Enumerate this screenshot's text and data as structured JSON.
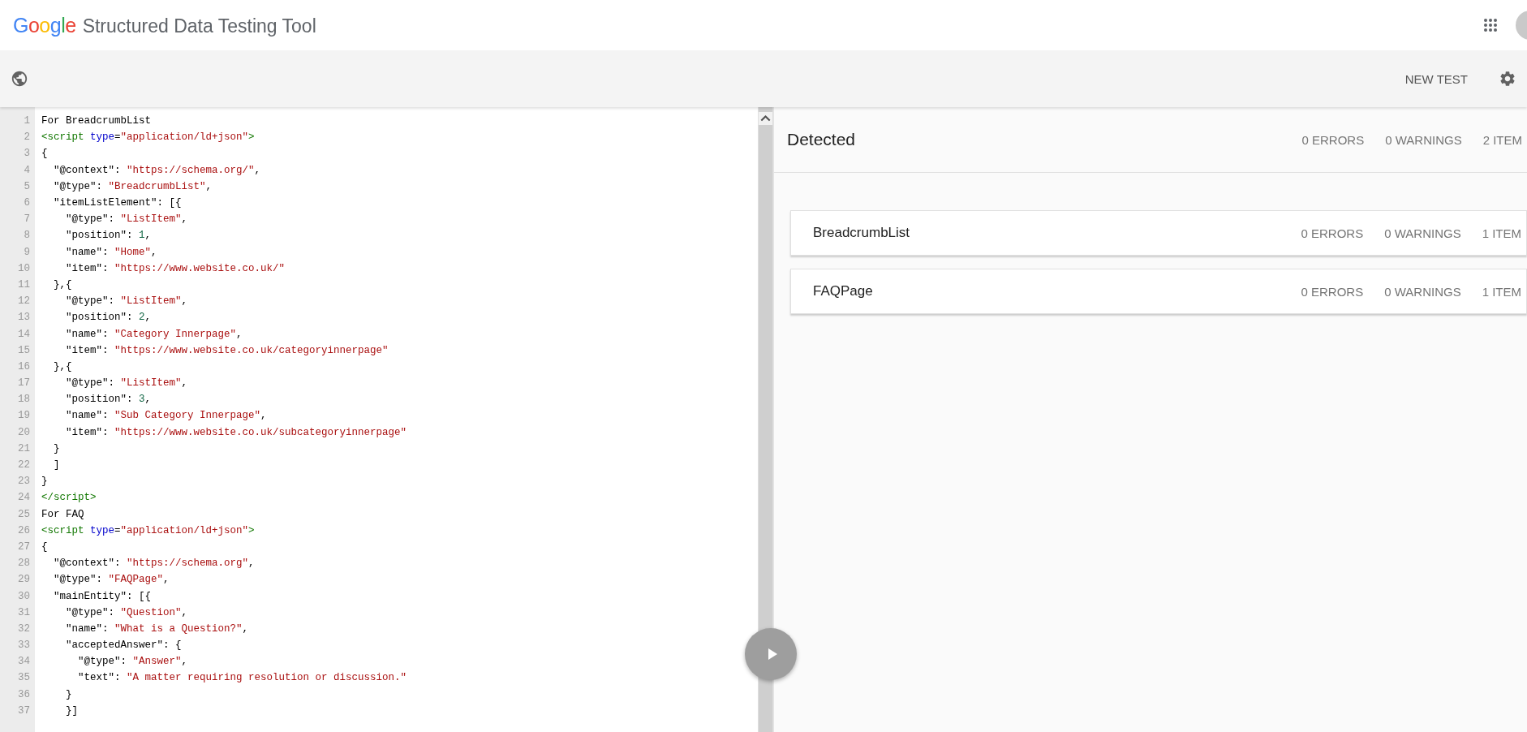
{
  "header": {
    "logo": "Google",
    "title": "Structured Data Testing Tool"
  },
  "toolbar": {
    "new_test": "NEW TEST"
  },
  "editor": {
    "lines": [
      {
        "n": "1",
        "tokens": [
          {
            "kind": "text",
            "text": "For BreadcrumbList"
          }
        ]
      },
      {
        "n": "2",
        "tokens": [
          {
            "kind": "tag",
            "text": "<script"
          },
          {
            "kind": "attr",
            "text": " type"
          },
          {
            "kind": "text",
            "text": "="
          },
          {
            "kind": "str",
            "text": "\"application/ld+json\""
          },
          {
            "kind": "tag",
            "text": ">"
          }
        ]
      },
      {
        "n": "3",
        "tokens": [
          {
            "kind": "text",
            "text": "{"
          }
        ]
      },
      {
        "n": "4",
        "tokens": [
          {
            "kind": "text",
            "text": "  \"@context\": "
          },
          {
            "kind": "str",
            "text": "\"https://schema.org/\""
          },
          {
            "kind": "text",
            "text": ","
          }
        ]
      },
      {
        "n": "5",
        "tokens": [
          {
            "kind": "text",
            "text": "  \"@type\": "
          },
          {
            "kind": "str",
            "text": "\"BreadcrumbList\""
          },
          {
            "kind": "text",
            "text": ","
          }
        ]
      },
      {
        "n": "6",
        "tokens": [
          {
            "kind": "text",
            "text": "  \"itemListElement\": [{"
          }
        ]
      },
      {
        "n": "7",
        "tokens": [
          {
            "kind": "text",
            "text": "    \"@type\": "
          },
          {
            "kind": "str",
            "text": "\"ListItem\""
          },
          {
            "kind": "text",
            "text": ","
          }
        ]
      },
      {
        "n": "8",
        "tokens": [
          {
            "kind": "text",
            "text": "    \"position\": "
          },
          {
            "kind": "num",
            "text": "1"
          },
          {
            "kind": "text",
            "text": ","
          }
        ]
      },
      {
        "n": "9",
        "tokens": [
          {
            "kind": "text",
            "text": "    \"name\": "
          },
          {
            "kind": "str",
            "text": "\"Home\""
          },
          {
            "kind": "text",
            "text": ","
          }
        ]
      },
      {
        "n": "10",
        "tokens": [
          {
            "kind": "text",
            "text": "    \"item\": "
          },
          {
            "kind": "str",
            "text": "\"https://www.website.co.uk/\""
          }
        ]
      },
      {
        "n": "11",
        "tokens": [
          {
            "kind": "text",
            "text": "  },{"
          }
        ]
      },
      {
        "n": "12",
        "tokens": [
          {
            "kind": "text",
            "text": "    \"@type\": "
          },
          {
            "kind": "str",
            "text": "\"ListItem\""
          },
          {
            "kind": "text",
            "text": ","
          }
        ]
      },
      {
        "n": "13",
        "tokens": [
          {
            "kind": "text",
            "text": "    \"position\": "
          },
          {
            "kind": "num",
            "text": "2"
          },
          {
            "kind": "text",
            "text": ","
          }
        ]
      },
      {
        "n": "14",
        "tokens": [
          {
            "kind": "text",
            "text": "    \"name\": "
          },
          {
            "kind": "str",
            "text": "\"Category Innerpage\""
          },
          {
            "kind": "text",
            "text": ","
          }
        ]
      },
      {
        "n": "15",
        "tokens": [
          {
            "kind": "text",
            "text": "    \"item\": "
          },
          {
            "kind": "str",
            "text": "\"https://www.website.co.uk/categoryinnerpage\""
          }
        ]
      },
      {
        "n": "16",
        "tokens": [
          {
            "kind": "text",
            "text": "  },{"
          }
        ]
      },
      {
        "n": "17",
        "tokens": [
          {
            "kind": "text",
            "text": "    \"@type\": "
          },
          {
            "kind": "str",
            "text": "\"ListItem\""
          },
          {
            "kind": "text",
            "text": ","
          }
        ]
      },
      {
        "n": "18",
        "tokens": [
          {
            "kind": "text",
            "text": "    \"position\": "
          },
          {
            "kind": "num",
            "text": "3"
          },
          {
            "kind": "text",
            "text": ","
          }
        ]
      },
      {
        "n": "19",
        "tokens": [
          {
            "kind": "text",
            "text": "    \"name\": "
          },
          {
            "kind": "str",
            "text": "\"Sub Category Innerpage\""
          },
          {
            "kind": "text",
            "text": ","
          }
        ]
      },
      {
        "n": "20",
        "tokens": [
          {
            "kind": "text",
            "text": "    \"item\": "
          },
          {
            "kind": "str",
            "text": "\"https://www.website.co.uk/subcategoryinnerpage\""
          }
        ]
      },
      {
        "n": "21",
        "tokens": [
          {
            "kind": "text",
            "text": "  }"
          }
        ]
      },
      {
        "n": "22",
        "tokens": [
          {
            "kind": "text",
            "text": "  ]"
          }
        ]
      },
      {
        "n": "23",
        "tokens": [
          {
            "kind": "text",
            "text": "}"
          }
        ]
      },
      {
        "n": "24",
        "tokens": [
          {
            "kind": "tag",
            "text": "</script>"
          }
        ]
      },
      {
        "n": "25",
        "tokens": [
          {
            "kind": "text",
            "text": "For FAQ"
          }
        ]
      },
      {
        "n": "26",
        "tokens": [
          {
            "kind": "tag",
            "text": "<script"
          },
          {
            "kind": "attr",
            "text": " type"
          },
          {
            "kind": "text",
            "text": "="
          },
          {
            "kind": "str",
            "text": "\"application/ld+json\""
          },
          {
            "kind": "tag",
            "text": ">"
          }
        ]
      },
      {
        "n": "27",
        "tokens": [
          {
            "kind": "text",
            "text": "{"
          }
        ]
      },
      {
        "n": "28",
        "tokens": [
          {
            "kind": "text",
            "text": "  \"@context\": "
          },
          {
            "kind": "str",
            "text": "\"https://schema.org\""
          },
          {
            "kind": "text",
            "text": ","
          }
        ]
      },
      {
        "n": "29",
        "tokens": [
          {
            "kind": "text",
            "text": "  \"@type\": "
          },
          {
            "kind": "str",
            "text": "\"FAQPage\""
          },
          {
            "kind": "text",
            "text": ","
          }
        ]
      },
      {
        "n": "30",
        "tokens": [
          {
            "kind": "text",
            "text": "  \"mainEntity\": [{"
          }
        ]
      },
      {
        "n": "31",
        "tokens": [
          {
            "kind": "text",
            "text": "    \"@type\": "
          },
          {
            "kind": "str",
            "text": "\"Question\""
          },
          {
            "kind": "text",
            "text": ","
          }
        ]
      },
      {
        "n": "32",
        "tokens": [
          {
            "kind": "text",
            "text": "    \"name\": "
          },
          {
            "kind": "str",
            "text": "\"What is a Question?\""
          },
          {
            "kind": "text",
            "text": ","
          }
        ]
      },
      {
        "n": "33",
        "tokens": [
          {
            "kind": "text",
            "text": "    \"acceptedAnswer\": {"
          }
        ]
      },
      {
        "n": "34",
        "tokens": [
          {
            "kind": "text",
            "text": "      \"@type\": "
          },
          {
            "kind": "str",
            "text": "\"Answer\""
          },
          {
            "kind": "text",
            "text": ","
          }
        ]
      },
      {
        "n": "35",
        "tokens": [
          {
            "kind": "text",
            "text": "      \"text\": "
          },
          {
            "kind": "str",
            "text": "\"A matter requiring resolution or discussion.\""
          }
        ]
      },
      {
        "n": "36",
        "tokens": [
          {
            "kind": "text",
            "text": "    }"
          }
        ]
      },
      {
        "n": "37",
        "tokens": [
          {
            "kind": "text",
            "text": "    }]"
          }
        ]
      }
    ]
  },
  "results": {
    "title": "Detected",
    "errors": "0 ERRORS",
    "warnings": "0 WARNINGS",
    "items": "2 ITEM",
    "entries": [
      {
        "name": "BreadcrumbList",
        "errors": "0 ERRORS",
        "warnings": "0 WARNINGS",
        "items": "1 ITEM"
      },
      {
        "name": "FAQPage",
        "errors": "0 ERRORS",
        "warnings": "0 WARNINGS",
        "items": "1 ITEM"
      }
    ]
  }
}
